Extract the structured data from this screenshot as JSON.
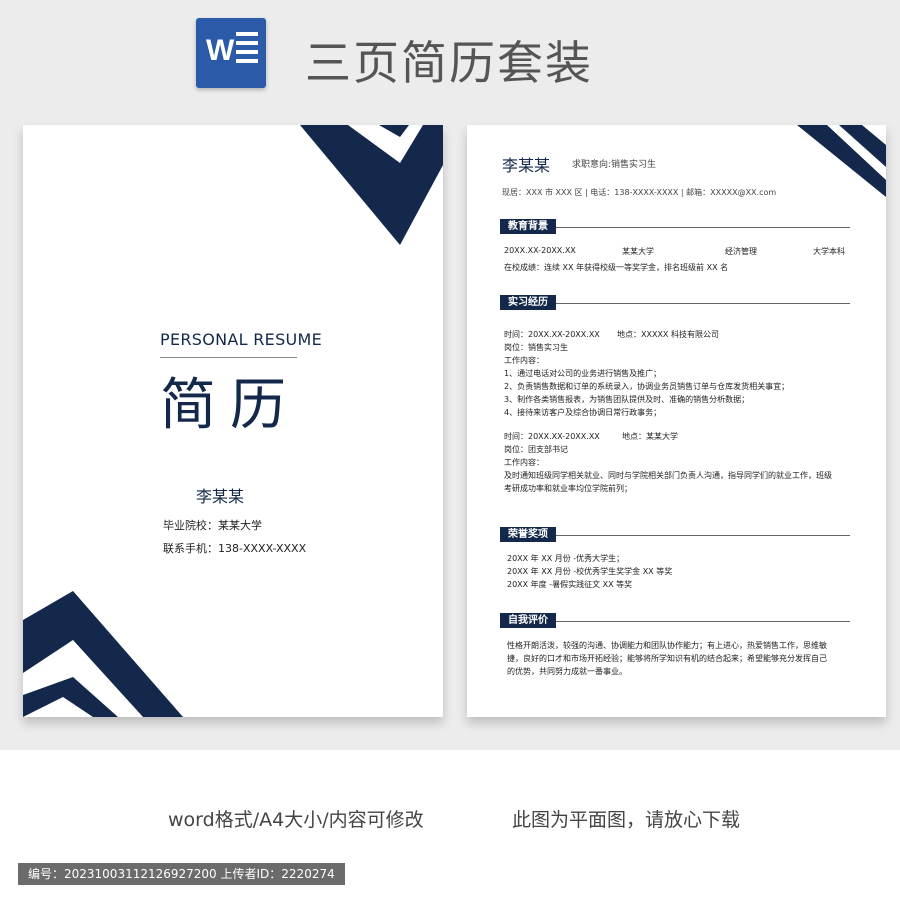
{
  "header": {
    "icon_letter": "W",
    "title": "三页简历套装"
  },
  "cover": {
    "english_title": "PERSONAL RESUME",
    "chinese_title": "简历",
    "name": "李某某",
    "school": "毕业院校：某某大学",
    "phone": "联系手机：138-XXXX-XXXX"
  },
  "resume": {
    "name": "李某某",
    "intent": "求职意向:销售实习生",
    "contact": "现居：XXX 市 XXX 区 | 电话：138-XXXX-XXXX | 邮箱：XXXXX@XX.com",
    "education": {
      "title": "教育背景",
      "cols": [
        "20XX.XX-20XX.XX",
        "某某大学",
        "经济管理",
        "大学本科"
      ],
      "note": "在校成绩：连续 XX 年获得校级一等奖学金，排名班级前 XX 名"
    },
    "internship": {
      "title": "实习经历",
      "job1": {
        "time": "时间：20XX.XX-20XX.XX",
        "place": "地点：XXXXX 科技有限公司",
        "post": "岗位：销售实习生",
        "label": "工作内容：",
        "items": [
          "1、通过电话对公司的业务进行销售及推广；",
          "2、负责销售数据和订单的系统录入，协调业务员销售订单与仓库发货相关事宜；",
          "3、制作各类销售报表，为销售团队提供及时、准确的销售分析数据；",
          "4、接待来访客户及综合协调日常行政事务；"
        ]
      },
      "job2": {
        "time": "时间：20XX.XX-20XX.XX",
        "place": "地点：某某大学",
        "post": "岗位：团支部书记",
        "label": "工作内容：",
        "desc1": "及时通知班级同学相关就业、同时与学院相关部门负责人沟通，指导同学们的就业工作，班级",
        "desc2": "考研成功率和就业率均位学院前列；"
      }
    },
    "honors": {
      "title": "荣誉奖项",
      "items": [
        "20XX 年 XX 月份  -优秀大学生；",
        "20XX 年 XX 月份  -校优秀学生奖学金 XX 等奖",
        "20XX 年度  -暑假实践征文 XX 等奖"
      ]
    },
    "self": {
      "title": "自我评价",
      "lines": [
        "性格开朗活泼，较强的沟通、协调能力和团队协作能力；有上进心，热爱销售工作，思维敏",
        "捷，良好的口才和市场开拓经验；能够将所学知识有机的结合起来；希望能够充分发挥自己",
        "的优势，共同努力成就一番事业。"
      ]
    }
  },
  "footer": {
    "caption_left": "word格式/A4大小/内容可修改",
    "caption_right": "此图为平面图，请放心下载",
    "meta": "编号：20231003112126927200   上传者ID：2220274"
  },
  "colors": {
    "navy": "#13284b",
    "word_blue": "#2b5ba8",
    "band_gray": "#ececec"
  }
}
